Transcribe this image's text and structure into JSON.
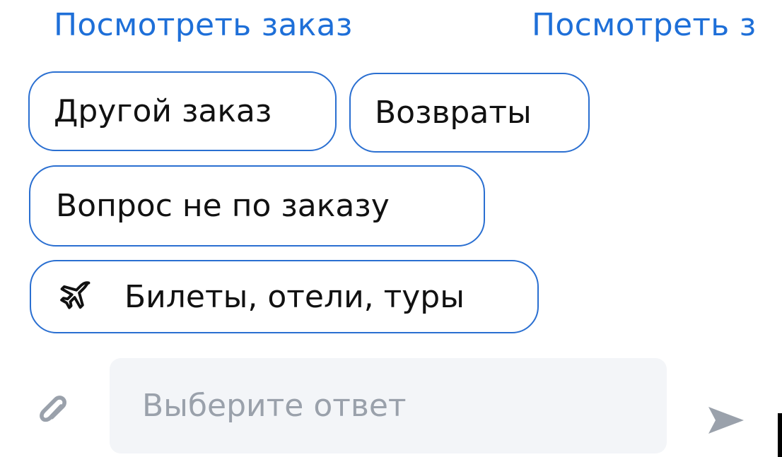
{
  "quick_links": [
    {
      "label": "Посмотреть заказ"
    },
    {
      "label": "Посмотреть з"
    }
  ],
  "chips": [
    {
      "label": "Другой заказ"
    },
    {
      "label": "Возвраты"
    },
    {
      "label": "Вопрос не по заказу"
    },
    {
      "label": "Билеты, отели, туры",
      "icon": "airplane-icon"
    }
  ],
  "composer": {
    "placeholder": "Выберите ответ",
    "attach_icon": "paperclip-icon",
    "send_icon": "send-icon"
  },
  "colors": {
    "accent": "#1e6fd8",
    "chip_border": "#2a6fd1",
    "input_bg": "#f3f5f8",
    "placeholder": "#9aa1ab",
    "icon_gray": "#9aa1ab"
  }
}
